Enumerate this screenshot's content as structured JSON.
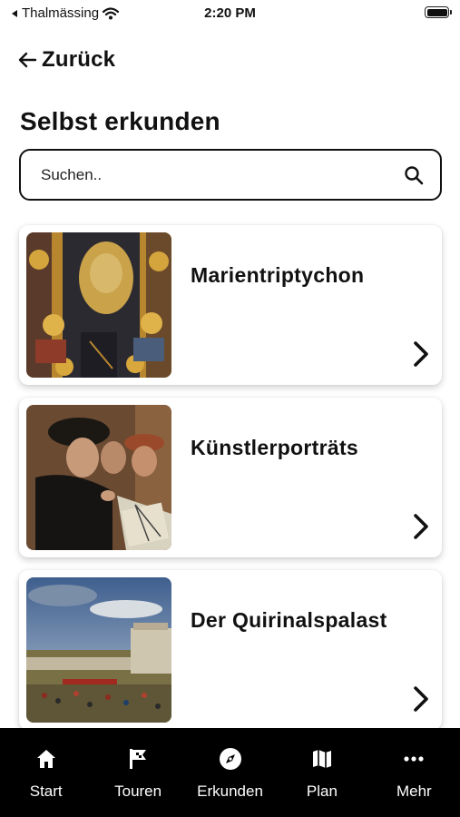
{
  "status_bar": {
    "carrier": "Thalmässing",
    "time": "2:20 PM"
  },
  "nav": {
    "back_label": "Zurück"
  },
  "page": {
    "title": "Selbst erkunden"
  },
  "search": {
    "placeholder": "Suchen.."
  },
  "cards": [
    {
      "title": "Marientriptychon"
    },
    {
      "title": "Künstlerporträts"
    },
    {
      "title": "Der Quirinalspalast"
    }
  ],
  "tabbar": {
    "tabs": [
      {
        "label": "Start",
        "icon": "home-icon"
      },
      {
        "label": "Touren",
        "icon": "flag-icon"
      },
      {
        "label": "Erkunden",
        "icon": "compass-icon"
      },
      {
        "label": "Plan",
        "icon": "map-icon"
      },
      {
        "label": "Mehr",
        "icon": "more-icon"
      }
    ]
  }
}
